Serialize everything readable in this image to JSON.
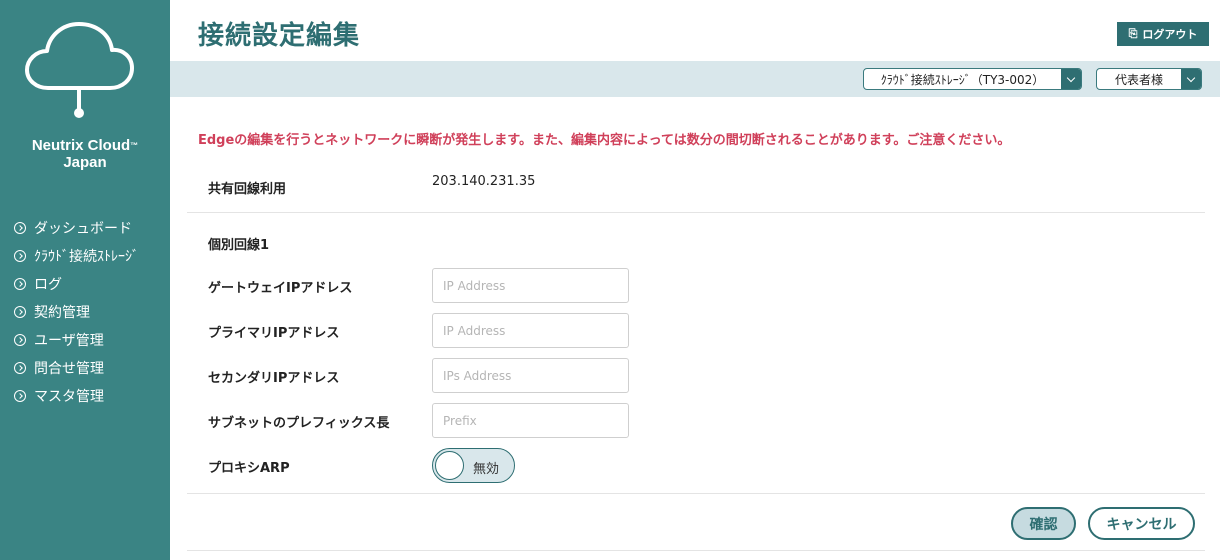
{
  "brand": {
    "line1": "Neutrix Cloud",
    "tm": "™",
    "line2": "Japan"
  },
  "sidebar": {
    "items": [
      {
        "label": "ダッシュボード"
      },
      {
        "label": "ｸﾗｳﾄﾞ接続ｽﾄﾚｰｼﾞ"
      },
      {
        "label": "ログ"
      },
      {
        "label": "契約管理"
      },
      {
        "label": "ユーザ管理"
      },
      {
        "label": "問合せ管理"
      },
      {
        "label": "マスタ管理"
      }
    ]
  },
  "header": {
    "title": "接続設定編集",
    "logout_label": "ログアウト",
    "storage_select": "ｸﾗｳﾄﾞ接続ｽﾄﾚｰｼﾞ（TY3-002）",
    "user_select": "代表者様"
  },
  "main": {
    "warning": "Edgeの編集を行うとネットワークに瞬断が発生します。また、編集内容によっては数分の間切断されることがあります。ご注意ください。",
    "shared_line": {
      "label": "共有回線利用",
      "value": "203.140.231.35"
    },
    "section_title": "個別回線1",
    "fields": [
      {
        "label": "ゲートウェイIPアドレス",
        "placeholder": "IP Address",
        "value": ""
      },
      {
        "label": "プライマリIPアドレス",
        "placeholder": "IP Address",
        "value": ""
      },
      {
        "label": "セカンダリIPアドレス",
        "placeholder": "IPs Address",
        "value": ""
      },
      {
        "label": "サブネットのプレフィックス長",
        "placeholder": "Prefix",
        "value": ""
      }
    ],
    "proxy_arp": {
      "label": "プロキシARP",
      "state": "無効"
    },
    "buttons": {
      "confirm": "確認",
      "cancel": "キャンセル"
    }
  },
  "colors": {
    "sidebar": "#3a8484",
    "accent": "#2e6e72",
    "warning": "#d0405a",
    "band": "#d9e7eb"
  },
  "icons": {
    "logo": "cloud-icon",
    "nav": "circle-chevron-right-icon",
    "logout": "logout-icon",
    "select": "chevron-down-icon"
  }
}
